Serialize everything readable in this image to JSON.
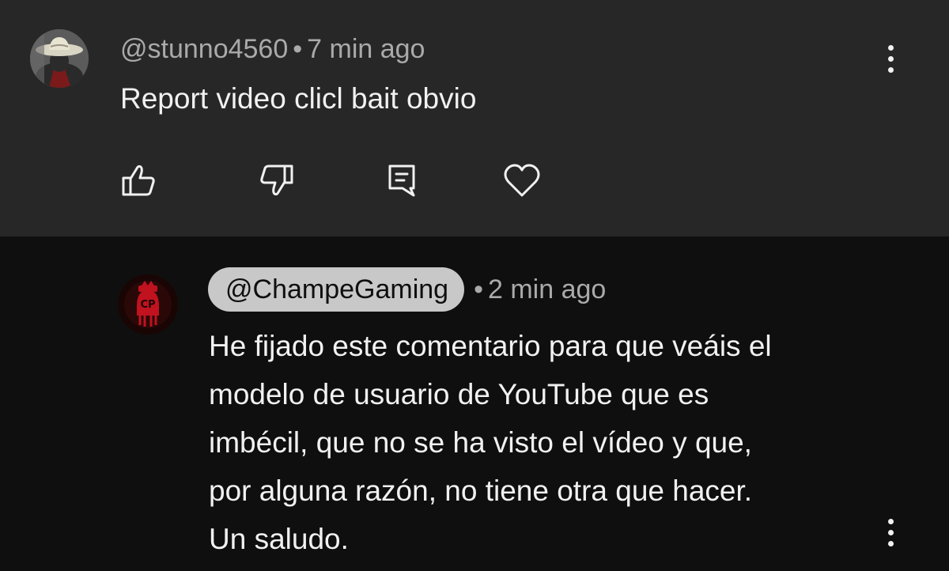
{
  "top_comment": {
    "author": "@stunno4560",
    "separator": "•",
    "time": "7 min ago",
    "text": "Report video clicl bait obvio",
    "avatar_icon": "profile-photo-cowboy-hat",
    "more_icon": "kebab-menu-icon",
    "actions": [
      {
        "name": "like",
        "icon": "thumbs-up-icon"
      },
      {
        "name": "dislike",
        "icon": "thumbs-down-icon"
      },
      {
        "name": "reply",
        "icon": "reply-comment-icon"
      },
      {
        "name": "heart",
        "icon": "heart-icon"
      }
    ]
  },
  "reply_comment": {
    "author": "@ChampeGaming",
    "separator": "•",
    "time": "2 min ago",
    "avatar_icon": "channel-logo-red",
    "avatar_logo_text": "CP",
    "more_icon": "kebab-menu-icon",
    "text_lines": [
      "He fijado este comentario para que veáis el",
      "modelo de usuario de YouTube que es",
      "imbécil, que no se ha visto el vídeo y que,",
      "por alguna razón, no tiene otra que hacer.",
      "Un saludo."
    ]
  },
  "colors": {
    "top_background": "#272727",
    "page_background": "#0f0f0f",
    "text_primary": "#f1f1f1",
    "text_secondary": "#aaaaaa",
    "chip_background": "#c8c8c8",
    "brand_red": "#c1121f"
  }
}
